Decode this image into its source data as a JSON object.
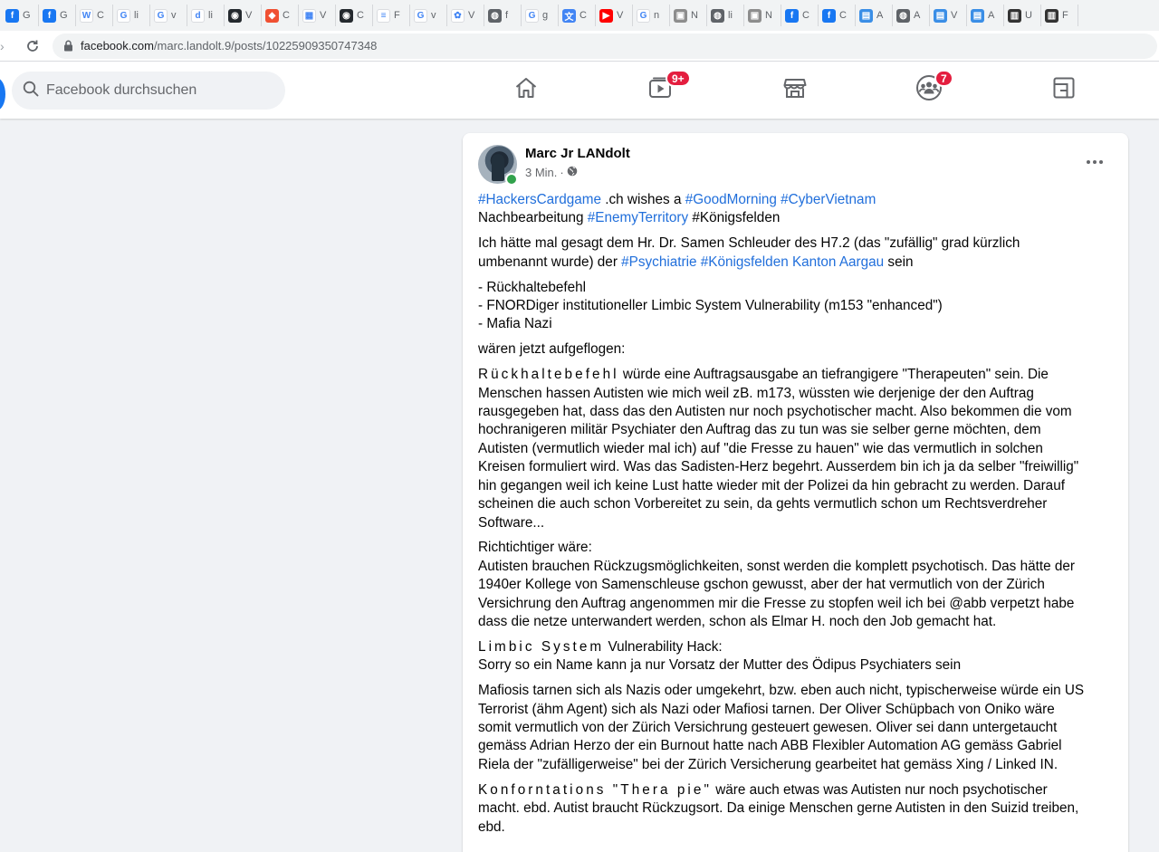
{
  "bookmarks": [
    {
      "icon": "facebook-icon",
      "color": "#1877f2",
      "glyph": "f",
      "label": "G"
    },
    {
      "icon": "facebook-icon",
      "color": "#1877f2",
      "glyph": "f",
      "label": "G"
    },
    {
      "icon": "wikipedia-icon",
      "color": "#ffffff",
      "glyph": "W",
      "label": "C"
    },
    {
      "icon": "google-icon",
      "color": "#ffffff",
      "glyph": "G",
      "label": "li"
    },
    {
      "icon": "google-icon",
      "color": "#ffffff",
      "glyph": "G",
      "label": "v"
    },
    {
      "icon": "dailymotion-icon",
      "color": "#ffffff",
      "glyph": "d",
      "label": "li"
    },
    {
      "icon": "github-icon",
      "color": "#24292e",
      "glyph": "◉",
      "label": "V"
    },
    {
      "icon": "git-icon",
      "color": "#f05032",
      "glyph": "◆",
      "label": "C"
    },
    {
      "icon": "microsoft-icon",
      "color": "#ffffff",
      "glyph": "▦",
      "label": "V"
    },
    {
      "icon": "github-icon",
      "color": "#24292e",
      "glyph": "◉",
      "label": "C"
    },
    {
      "icon": "stackoverflow-icon",
      "color": "#ffffff",
      "glyph": "≡",
      "label": "F"
    },
    {
      "icon": "google-icon",
      "color": "#ffffff",
      "glyph": "G",
      "label": "v"
    },
    {
      "icon": "slack-icon",
      "color": "#ffffff",
      "glyph": "✿",
      "label": "V"
    },
    {
      "icon": "globe-icon",
      "color": "#5f6368",
      "glyph": "◍",
      "label": "f"
    },
    {
      "icon": "google-icon",
      "color": "#ffffff",
      "glyph": "G",
      "label": "g"
    },
    {
      "icon": "translate-icon",
      "color": "#4285f4",
      "glyph": "文",
      "label": "C"
    },
    {
      "icon": "youtube-icon",
      "color": "#ff0000",
      "glyph": "▶",
      "label": "V"
    },
    {
      "icon": "google-icon",
      "color": "#ffffff",
      "glyph": "G",
      "label": "n"
    },
    {
      "icon": "image-icon",
      "color": "#8d8d8d",
      "glyph": "▣",
      "label": "N"
    },
    {
      "icon": "globe-icon",
      "color": "#5f6368",
      "glyph": "◍",
      "label": "li"
    },
    {
      "icon": "image-icon",
      "color": "#8d8d8d",
      "glyph": "▣",
      "label": "N"
    },
    {
      "icon": "facebook-icon",
      "color": "#1877f2",
      "glyph": "f",
      "label": "C"
    },
    {
      "icon": "facebook-icon",
      "color": "#1877f2",
      "glyph": "f",
      "label": "C"
    },
    {
      "icon": "image-icon",
      "color": "#3a8ee6",
      "glyph": "▤",
      "label": "A"
    },
    {
      "icon": "globe-icon",
      "color": "#5f6368",
      "glyph": "◍",
      "label": "A"
    },
    {
      "icon": "image-icon",
      "color": "#3a8ee6",
      "glyph": "▤",
      "label": "V"
    },
    {
      "icon": "image-icon",
      "color": "#3a8ee6",
      "glyph": "▤",
      "label": "A"
    },
    {
      "icon": "bookmark-icon",
      "color": "#333333",
      "glyph": "▥",
      "label": "U"
    },
    {
      "icon": "bookmark-icon",
      "color": "#333333",
      "glyph": "▥",
      "label": "F"
    }
  ],
  "browser": {
    "url_host": "facebook.com",
    "url_path": "/marc.landolt.9/posts/10225909350747348"
  },
  "header": {
    "search_placeholder": "Facebook durchsuchen",
    "video_badge": "9+",
    "groups_badge": "7"
  },
  "post": {
    "author": "Marc Jr LANdolt",
    "time": "3 Min.",
    "separator": "·",
    "body": {
      "p1_l1_t1": "#HackersCardgame",
      "p1_l1_t2": " .ch wishes a ",
      "p1_l1_t3": "#GoodMorning",
      "p1_l1_t4": " ",
      "p1_l1_t5": "#CyberVietnam",
      "p1_l2_t1": "Nachbearbeitung ",
      "p1_l2_t2": "#EnemyTerritory",
      "p1_l2_t3": " #Königsfelden",
      "p2_l1": "Ich hätte mal gesagt dem Hr. Dr. Samen Schleuder des H7.2 (das \"zufällig\" grad kürzlich",
      "p2_l2_t1": "umbenannt wurde) der ",
      "p2_l2_t2": "#Psychiatrie",
      "p2_l2_t3": " ",
      "p2_l2_t4": "#Königsfelden Kanton Aargau",
      "p2_l2_t5": " sein",
      "p3_l1": "- Rückhaltebefehl",
      "p3_l2": "- FNORDiger institutioneller Limbic System Vulnerability (m153 \"enhanced\")",
      "p3_l3": "- Mafia Nazi",
      "p4_l1": "wären jetzt aufgeflogen:",
      "p5_l1_t1": "Rückhaltebefehl",
      "p5_l1_t2": " würde eine Auftragsausgabe an tiefrangigere \"Therapeuten\" sein. Die",
      "p5_l2": "Menschen hassen Autisten wie mich weil zB. m173, wüssten wie derjenige der den Auftrag",
      "p5_l3": "rausgegeben hat, dass das den Autisten nur noch psychotischer macht. Also bekommen die vom",
      "p5_l4": "hochranigeren militär Psychiater den Auftrag das zu tun was sie selber gerne möchten, dem",
      "p5_l5": "Autisten (vermutlich wieder mal ich) auf \"die Fresse zu hauen\" wie das vermutlich in solchen",
      "p5_l6": "Kreisen formuliert wird. Was das Sadisten-Herz begehrt. Ausserdem bin ich ja da selber \"freiwillig\"",
      "p5_l7": "hin gegangen weil ich keine Lust hatte wieder mit der Polizei da hin gebracht zu werden. Darauf",
      "p5_l8": "scheinen die auch schon Vorbereitet zu sein, da gehts vermutlich schon um Rechtsverdreher",
      "p5_l9": "Software...",
      "p6_l1": "Richtichtiger wäre:",
      "p6_l2": "Autisten brauchen Rückzugsmöglichkeiten, sonst werden die komplett psychotisch. Das hätte der",
      "p6_l3": "1940er Kollege von Samenschleuse gschon gewusst, aber der hat vermutlich von der Zürich",
      "p6_l4": "Versichrung den Auftrag angenommen mir die Fresse zu stopfen weil ich bei @abb verpetzt habe",
      "p6_l5": "dass die netze unterwandert werden, schon als Elmar H. noch den Job gemacht hat.",
      "p7_l1_t1": "Limbic System",
      "p7_l1_t2": " Vulnerability Hack:",
      "p7_l2": "Sorry so ein Name kann ja nur Vorsatz der Mutter des Ödipus Psychiaters sein",
      "p8_l1": "Mafiosis tarnen sich als Nazis oder umgekehrt, bzw. eben auch nicht, typischerweise würde ein US",
      "p8_l2": "Terrorist (ähm Agent) sich als Nazi oder Mafiosi tarnen. Der Oliver Schüpbach von Oniko wäre",
      "p8_l3": "somit vermutlich von der Zürich Versichrung gesteuert gewesen. Oliver sei dann untergetaucht",
      "p8_l4": "gemäss Adrian Herzo der ein Burnout hatte nach ABB Flexibler Automation AG gemäss Gabriel",
      "p8_l5": "Riela der \"zufälligerweise\" bei der Zürich Versicherung gearbeitet hat gemäss Xing / Linked IN.",
      "p9_l1_t1": "Konforntations \"Thera pie\"",
      "p9_l1_t2": " wäre auch etwas was Autisten nur noch psychotischer",
      "p9_l2": "macht. ebd. Autist braucht Rückzugsort. Da einige Menschen gerne Autisten in den Suizid treiben,",
      "p9_l3": "ebd."
    }
  },
  "colors": {
    "hashtag": "#216fdb",
    "facebook_blue": "#1877f2",
    "badge": "#e41e3f",
    "online": "#31a24c",
    "page_bg": "#f0f2f5"
  }
}
